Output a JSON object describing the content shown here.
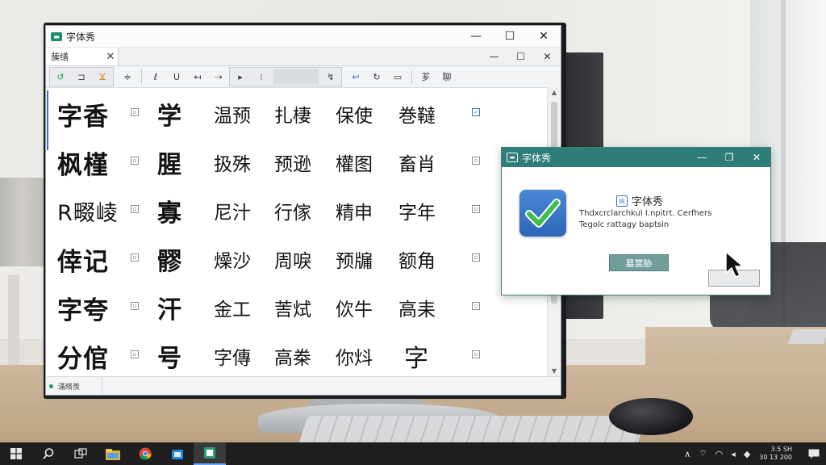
{
  "app": {
    "title": "字体秀",
    "doc_tab": "蔟缮",
    "status_text": "滿络羨"
  },
  "toolbar": {
    "buttons": [
      "↺",
      "⊐",
      "Ϫ",
      "≑",
      "ℓ",
      "U",
      "↤",
      "⇢",
      "▸",
      "⁝",
      "↯",
      "↩",
      "↻",
      "▭",
      "芗",
      "聊"
    ]
  },
  "glyph_rows": [
    {
      "cells": [
        "字香",
        "学",
        "温预",
        "扎棲",
        "保使",
        "巻韃"
      ]
    },
    {
      "cells": [
        "枫槿",
        "腥",
        "扱殊",
        "预逊",
        "權图",
        "畜肖"
      ]
    },
    {
      "cells": [
        "R畷崚",
        "寡",
        "尼汁",
        "行傢",
        "精申",
        "字年"
      ]
    },
    {
      "cells": [
        "倖记",
        "髎",
        "燥沙",
        "周唳",
        "预牖",
        "额角"
      ]
    },
    {
      "cells": [
        "字夸",
        "汗",
        "金工",
        "䓀烒",
        "佽牛",
        "高耒"
      ]
    },
    {
      "cells": [
        "分倌",
        "号",
        "字傳",
        "高桊",
        "你炓",
        "字"
      ]
    }
  ],
  "dialog": {
    "title": "字体秀",
    "heading": "字体秀",
    "line1": "Thdxcrclarchkul I.npitrt. Cerfhers",
    "line2": "Tegolc rattagy baptsin",
    "primary_button": "墓裳胁"
  },
  "colors": {
    "titlebar_accent": "#2e7d78",
    "badge_blue": "#2e66b8",
    "check_green": "#3fbf4a",
    "status_green": "#1a9e5c"
  },
  "taskbar": {
    "icons": [
      "windows-start-icon",
      "search-icon",
      "task-view-icon",
      "file-explorer-icon",
      "chrome-icon",
      "store-icon",
      "font-app-icon"
    ],
    "clock_time": "3.5 SH",
    "clock_date": "30 13 200"
  }
}
